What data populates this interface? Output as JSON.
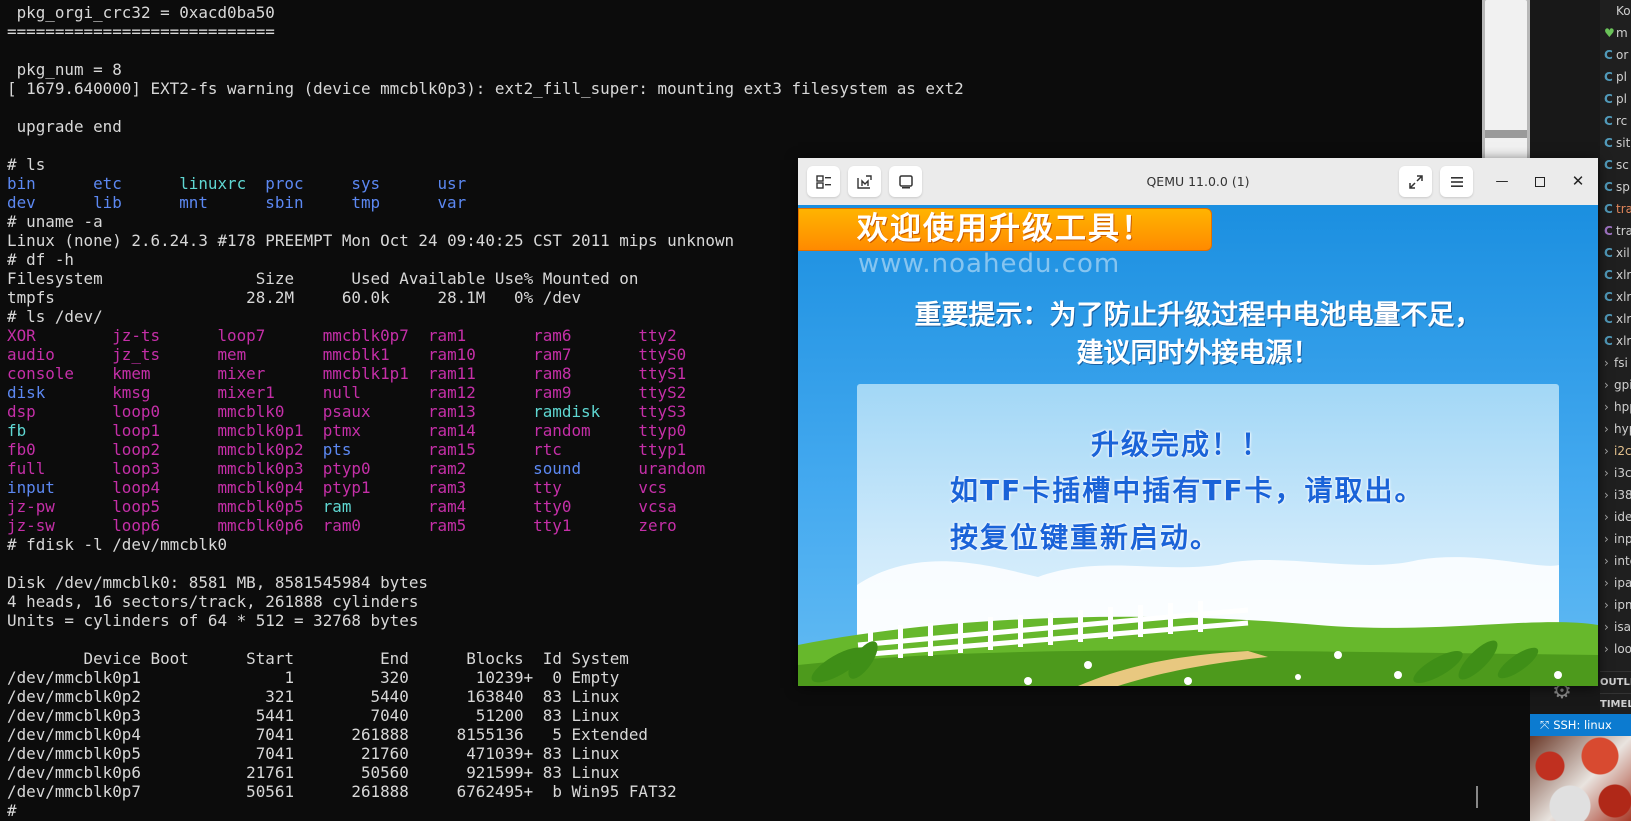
{
  "terminal": {
    "lines": [
      [
        {
          "t": " pkg_orgi_crc32 = 0xacd0ba50",
          "c": "def"
        }
      ],
      [
        {
          "t": "============================",
          "c": "def"
        }
      ],
      [
        {
          "t": "",
          "c": "def"
        }
      ],
      [
        {
          "t": " pkg_num = 8",
          "c": "def"
        }
      ],
      [
        {
          "t": "[ 1679.640000] EXT2-fs warning (device mmcblk0p3): ext2_fill_super: mounting ext3 filesystem as ext2",
          "c": "def"
        }
      ],
      [
        {
          "t": "",
          "c": "def"
        }
      ],
      [
        {
          "t": " upgrade end",
          "c": "def"
        }
      ],
      [
        {
          "t": "",
          "c": "def"
        }
      ],
      [
        {
          "t": "# ls",
          "c": "def"
        }
      ],
      [
        {
          "t": "bin",
          "c": "blue",
          "w": 9
        },
        {
          "t": "etc",
          "c": "blue",
          "w": 9
        },
        {
          "t": "linuxrc",
          "c": "cyan",
          "w": 9
        },
        {
          "t": "proc",
          "c": "blue",
          "w": 9
        },
        {
          "t": "sys",
          "c": "blue",
          "w": 9
        },
        {
          "t": "usr",
          "c": "blue",
          "w": 9
        }
      ],
      [
        {
          "t": "dev",
          "c": "blue",
          "w": 9
        },
        {
          "t": "lib",
          "c": "blue",
          "w": 9
        },
        {
          "t": "mnt",
          "c": "blue",
          "w": 9
        },
        {
          "t": "sbin",
          "c": "blue",
          "w": 9
        },
        {
          "t": "tmp",
          "c": "blue",
          "w": 9
        },
        {
          "t": "var",
          "c": "blue",
          "w": 9
        }
      ],
      [
        {
          "t": "# uname -a",
          "c": "def"
        }
      ],
      [
        {
          "t": "Linux (none) 2.6.24.3 #178 PREEMPT Mon Oct 24 09:40:25 CST 2011 mips unknown",
          "c": "def"
        }
      ],
      [
        {
          "t": "# df -h",
          "c": "def"
        }
      ],
      [
        {
          "t": "Filesystem                Size      Used Available Use% Mounted on",
          "c": "def"
        }
      ],
      [
        {
          "t": "tmpfs                    28.2M     60.0k     28.1M   0% /dev",
          "c": "def"
        }
      ],
      [
        {
          "t": "# ls /dev/",
          "c": "def"
        }
      ],
      [
        {
          "t": "XOR",
          "c": "mag",
          "w": 11
        },
        {
          "t": "jz-ts",
          "c": "mag",
          "w": 11
        },
        {
          "t": "loop7",
          "c": "mag",
          "w": 11
        },
        {
          "t": "mmcblk0p7",
          "c": "mag",
          "w": 11
        },
        {
          "t": "ram1",
          "c": "mag",
          "w": 11
        },
        {
          "t": "ram6",
          "c": "mag",
          "w": 11
        },
        {
          "t": "tty2",
          "c": "mag",
          "w": 11
        }
      ],
      [
        {
          "t": "audio",
          "c": "mag",
          "w": 11
        },
        {
          "t": "jz_ts",
          "c": "mag",
          "w": 11
        },
        {
          "t": "mem",
          "c": "mag",
          "w": 11
        },
        {
          "t": "mmcblk1",
          "c": "mag",
          "w": 11
        },
        {
          "t": "ram10",
          "c": "mag",
          "w": 11
        },
        {
          "t": "ram7",
          "c": "mag",
          "w": 11
        },
        {
          "t": "ttyS0",
          "c": "mag",
          "w": 11
        }
      ],
      [
        {
          "t": "console",
          "c": "mag",
          "w": 11
        },
        {
          "t": "kmem",
          "c": "mag",
          "w": 11
        },
        {
          "t": "mixer",
          "c": "mag",
          "w": 11
        },
        {
          "t": "mmcblk1p1",
          "c": "mag",
          "w": 11
        },
        {
          "t": "ram11",
          "c": "mag",
          "w": 11
        },
        {
          "t": "ram8",
          "c": "mag",
          "w": 11
        },
        {
          "t": "ttyS1",
          "c": "mag",
          "w": 11
        }
      ],
      [
        {
          "t": "disk",
          "c": "blue",
          "w": 11
        },
        {
          "t": "kmsg",
          "c": "mag",
          "w": 11
        },
        {
          "t": "mixer1",
          "c": "mag",
          "w": 11
        },
        {
          "t": "null",
          "c": "mag",
          "w": 11
        },
        {
          "t": "ram12",
          "c": "mag",
          "w": 11
        },
        {
          "t": "ram9",
          "c": "mag",
          "w": 11
        },
        {
          "t": "ttyS2",
          "c": "mag",
          "w": 11
        }
      ],
      [
        {
          "t": "dsp",
          "c": "mag",
          "w": 11
        },
        {
          "t": "loop0",
          "c": "mag",
          "w": 11
        },
        {
          "t": "mmcblk0",
          "c": "mag",
          "w": 11
        },
        {
          "t": "psaux",
          "c": "mag",
          "w": 11
        },
        {
          "t": "ram13",
          "c": "mag",
          "w": 11
        },
        {
          "t": "ramdisk",
          "c": "cyan",
          "w": 11
        },
        {
          "t": "ttyS3",
          "c": "mag",
          "w": 11
        }
      ],
      [
        {
          "t": "fb",
          "c": "cyan",
          "w": 11
        },
        {
          "t": "loop1",
          "c": "mag",
          "w": 11
        },
        {
          "t": "mmcblk0p1",
          "c": "mag",
          "w": 11
        },
        {
          "t": "ptmx",
          "c": "mag",
          "w": 11
        },
        {
          "t": "ram14",
          "c": "mag",
          "w": 11
        },
        {
          "t": "random",
          "c": "mag",
          "w": 11
        },
        {
          "t": "ttyp0",
          "c": "mag",
          "w": 11
        }
      ],
      [
        {
          "t": "fb0",
          "c": "mag",
          "w": 11
        },
        {
          "t": "loop2",
          "c": "mag",
          "w": 11
        },
        {
          "t": "mmcblk0p2",
          "c": "mag",
          "w": 11
        },
        {
          "t": "pts",
          "c": "blue",
          "w": 11
        },
        {
          "t": "ram15",
          "c": "mag",
          "w": 11
        },
        {
          "t": "rtc",
          "c": "mag",
          "w": 11
        },
        {
          "t": "ttyp1",
          "c": "mag",
          "w": 11
        }
      ],
      [
        {
          "t": "full",
          "c": "mag",
          "w": 11
        },
        {
          "t": "loop3",
          "c": "mag",
          "w": 11
        },
        {
          "t": "mmcblk0p3",
          "c": "mag",
          "w": 11
        },
        {
          "t": "ptyp0",
          "c": "mag",
          "w": 11
        },
        {
          "t": "ram2",
          "c": "mag",
          "w": 11
        },
        {
          "t": "sound",
          "c": "blue",
          "w": 11
        },
        {
          "t": "urandom",
          "c": "mag",
          "w": 11
        }
      ],
      [
        {
          "t": "input",
          "c": "blue",
          "w": 11
        },
        {
          "t": "loop4",
          "c": "mag",
          "w": 11
        },
        {
          "t": "mmcblk0p4",
          "c": "mag",
          "w": 11
        },
        {
          "t": "ptyp1",
          "c": "mag",
          "w": 11
        },
        {
          "t": "ram3",
          "c": "mag",
          "w": 11
        },
        {
          "t": "tty",
          "c": "mag",
          "w": 11
        },
        {
          "t": "vcs",
          "c": "mag",
          "w": 11
        }
      ],
      [
        {
          "t": "jz-pw",
          "c": "mag",
          "w": 11
        },
        {
          "t": "loop5",
          "c": "mag",
          "w": 11
        },
        {
          "t": "mmcblk0p5",
          "c": "mag",
          "w": 11
        },
        {
          "t": "ram",
          "c": "cyan",
          "w": 11
        },
        {
          "t": "ram4",
          "c": "mag",
          "w": 11
        },
        {
          "t": "tty0",
          "c": "mag",
          "w": 11
        },
        {
          "t": "vcsa",
          "c": "mag",
          "w": 11
        }
      ],
      [
        {
          "t": "jz-sw",
          "c": "mag",
          "w": 11
        },
        {
          "t": "loop6",
          "c": "mag",
          "w": 11
        },
        {
          "t": "mmcblk0p6",
          "c": "mag",
          "w": 11
        },
        {
          "t": "ram0",
          "c": "mag",
          "w": 11
        },
        {
          "t": "ram5",
          "c": "mag",
          "w": 11
        },
        {
          "t": "tty1",
          "c": "mag",
          "w": 11
        },
        {
          "t": "zero",
          "c": "mag",
          "w": 11
        }
      ],
      [
        {
          "t": "# fdisk -l /dev/mmcblk0",
          "c": "def"
        }
      ],
      [
        {
          "t": "",
          "c": "def"
        }
      ],
      [
        {
          "t": "Disk /dev/mmcblk0: 8581 MB, 8581545984 bytes",
          "c": "def"
        }
      ],
      [
        {
          "t": "4 heads, 16 sectors/track, 261888 cylinders",
          "c": "def"
        }
      ],
      [
        {
          "t": "Units = cylinders of 64 * 512 = 32768 bytes",
          "c": "def"
        }
      ],
      [
        {
          "t": "",
          "c": "def"
        }
      ],
      [
        {
          "t": "        Device Boot      Start         End      Blocks  Id System",
          "c": "def"
        }
      ],
      [
        {
          "t": "/dev/mmcblk0p1               1         320       10239+  0 Empty",
          "c": "def"
        }
      ],
      [
        {
          "t": "/dev/mmcblk0p2             321        5440      163840  83 Linux",
          "c": "def"
        }
      ],
      [
        {
          "t": "/dev/mmcblk0p3            5441        7040       51200  83 Linux",
          "c": "def"
        }
      ],
      [
        {
          "t": "/dev/mmcblk0p4            7041      261888     8155136   5 Extended",
          "c": "def"
        }
      ],
      [
        {
          "t": "/dev/mmcblk0p5            7041       21760      471039+ 83 Linux",
          "c": "def"
        }
      ],
      [
        {
          "t": "/dev/mmcblk0p6           21761       50560      921599+ 83 Linux",
          "c": "def"
        }
      ],
      [
        {
          "t": "/dev/mmcblk0p7           50561      261888     6762495+  b Win95 FAT32",
          "c": "def"
        }
      ],
      [
        {
          "t": "#",
          "c": "def"
        }
      ]
    ]
  },
  "qemu": {
    "title": "QEMU 11.0.0 (1)",
    "buttons": [
      "tabs-icon",
      "keyboard-capture-icon",
      "display-icon"
    ],
    "screen": {
      "banner": "欢迎使用升级工具！",
      "watermark": "www.noahedu.com",
      "notice_line1": "重要提示：为了防止升级过程中电池电量不足，",
      "notice_line2": "建议同时外接电源！",
      "status_line1": "升级完成！！",
      "status_line2": "如TF卡插槽中插有TF卡，请取出。",
      "status_line3": "按复位键重新启动。"
    }
  },
  "vscode": {
    "files": [
      {
        "icon": "",
        "name": "Ko",
        "color": "#cfcfcf"
      },
      {
        "icon": "♥",
        "name": "m",
        "color": "#6ac259"
      },
      {
        "icon": "C",
        "name": "or",
        "color": "#519aba"
      },
      {
        "icon": "C",
        "name": "pl",
        "color": "#519aba"
      },
      {
        "icon": "C",
        "name": "pl",
        "color": "#519aba"
      },
      {
        "icon": "C",
        "name": "rc",
        "color": "#519aba"
      },
      {
        "icon": "C",
        "name": "sit",
        "color": "#519aba"
      },
      {
        "icon": "C",
        "name": "sc",
        "color": "#519aba"
      },
      {
        "icon": "C",
        "name": "sp",
        "color": "#519aba"
      },
      {
        "icon": "C",
        "name": "tra",
        "color": "#519aba",
        "name_color": "#e2865a"
      },
      {
        "icon": "C",
        "name": "tra",
        "color": "#a074c4"
      },
      {
        "icon": "C",
        "name": "xil",
        "color": "#519aba"
      },
      {
        "icon": "C",
        "name": "xlr",
        "color": "#519aba"
      },
      {
        "icon": "C",
        "name": "xlr",
        "color": "#519aba"
      },
      {
        "icon": "C",
        "name": "xlr",
        "color": "#519aba"
      },
      {
        "icon": "C",
        "name": "xlr",
        "color": "#519aba"
      }
    ],
    "folders": [
      "fsi",
      "gpi",
      "hpp",
      "hyp",
      "i2c",
      "i3c",
      "i38",
      "ide",
      "inp",
      "inte",
      "ipa",
      "ipm",
      "isa",
      "loo"
    ],
    "outline_label": "OUTLIN",
    "timeline_label": "TIMELI",
    "status_text": "SSH: linux"
  }
}
